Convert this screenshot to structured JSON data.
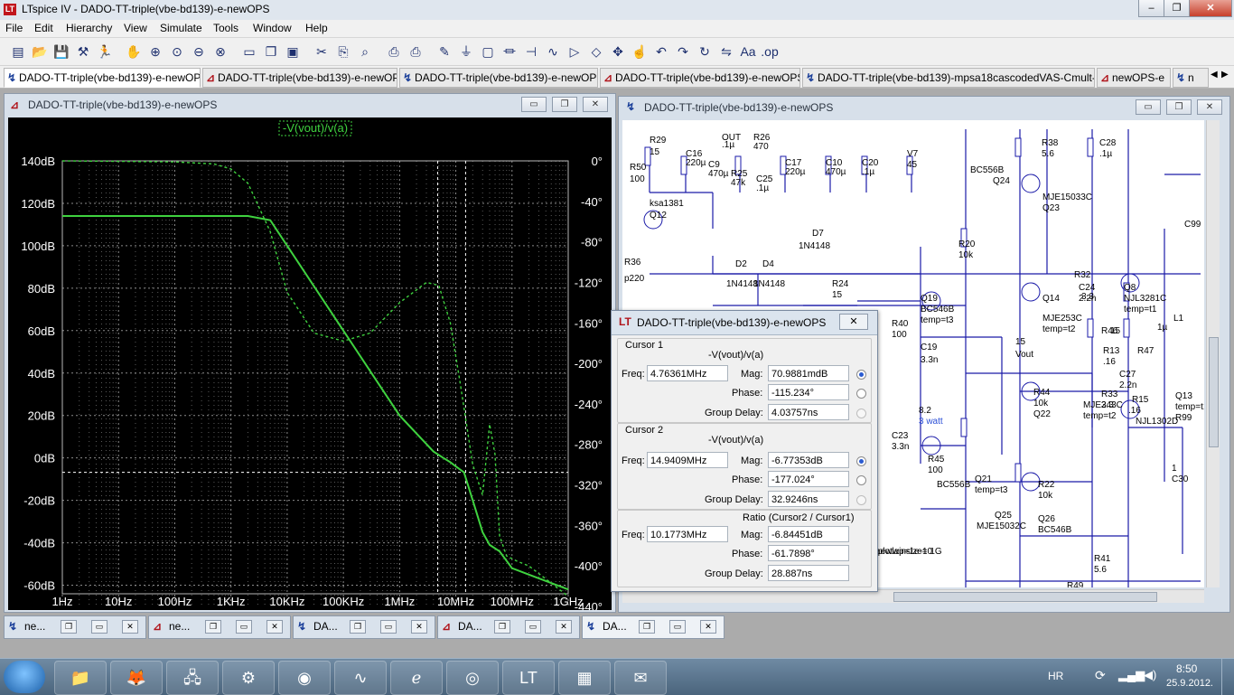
{
  "app": {
    "title": "LTspice IV - DADO-TT-triple(vbe-bd139)-e-newOPS",
    "controls": [
      "–",
      "❐",
      "✕"
    ]
  },
  "menu": [
    "File",
    "Edit",
    "Hierarchy",
    "View",
    "Simulate",
    "Tools",
    "Window",
    "Help"
  ],
  "toolbar_icons": [
    "new-schematic-icon",
    "open-icon",
    "save-icon",
    "control-panel-icon",
    "run-icon",
    "halt-icon",
    "zoom-in-icon",
    "zoom-pan-icon",
    "zoom-out-icon",
    "zoom-cancel-icon",
    "tile-horizontal-icon",
    "cascade-icon",
    "close-window-icon",
    "cut-icon",
    "copy-icon",
    "find-icon",
    "print-setup-icon",
    "print-icon",
    "wire-icon",
    "ground-icon",
    "label-icon",
    "resistor-icon",
    "capacitor-icon",
    "inductor-icon",
    "diode-icon",
    "component-icon",
    "move-icon",
    "drag-icon",
    "undo-icon",
    "redo-icon",
    "rotate-icon",
    "mirror-icon",
    "text-icon",
    "spice-directive-icon"
  ],
  "tabs": [
    {
      "label": "DADO-TT-triple(vbe-bd139)-e-newOPS",
      "icon": "schematic-icon",
      "active": true
    },
    {
      "label": "DADO-TT-triple(vbe-bd139)-e-newOPS",
      "icon": "waveform-icon",
      "active": false
    },
    {
      "label": "DADO-TT-triple(vbe-bd139)-e-newOPS-f",
      "icon": "schematic-icon",
      "active": false
    },
    {
      "label": "DADO-TT-triple(vbe-bd139)-e-newOPS-f",
      "icon": "waveform-icon",
      "active": false
    },
    {
      "label": "DADO-TT-triple(vbe-bd139)-mpsa18cascodedVAS-Cmult-mk2",
      "icon": "schematic-icon",
      "active": false
    },
    {
      "label": "newOPS-e",
      "icon": "waveform-icon",
      "active": false
    },
    {
      "label": "n",
      "icon": "schematic-icon",
      "active": false
    }
  ],
  "plot_window": {
    "title": "DADO-TT-triple(vbe-bd139)-e-newOPS",
    "controls": [
      "▭",
      "❐",
      "✕"
    ]
  },
  "schematic_window": {
    "title": "DADO-TT-triple(vbe-bd139)-e-newOPS",
    "controls": [
      "▭",
      "❐",
      "✕"
    ],
    "labels": [
      "R29",
      "15",
      "R50",
      "100",
      "C16",
      "220µ",
      "C9",
      "470µ",
      "R25",
      "47k",
      "R26",
      "470",
      "C25",
      ".1µ",
      "C17",
      "220µ",
      "C10",
      "470µ",
      "C20",
      ".1µ",
      "V7",
      "45",
      "ksa1381",
      "Q12",
      "R36",
      "p220",
      "D7",
      "1N4148",
      "D2",
      "D4",
      "1N4148",
      "1N4148",
      "R24",
      "15",
      "R20",
      "10k",
      "R38",
      "5.6",
      "C28",
      ".1µ",
      "BC556B",
      "Q24",
      "MJE15033C",
      "Q23",
      "Q19",
      "BC546B",
      "temp=t3",
      "R40",
      "100",
      "C19",
      "3.3n",
      "Q14",
      "MJE253C",
      "temp=t2",
      "R32",
      "3.3",
      "C24",
      "2.2n",
      "Q8",
      "NJL3281C",
      "temp=t1",
      "L1",
      "1µ",
      "R46",
      "15",
      "R13",
      ".16",
      "R47",
      "15",
      "Vout",
      "R44",
      "10k",
      "Q22",
      "MJE243C",
      "temp=t2",
      "R33",
      "3.3",
      "C27",
      "2.2n",
      "R15",
      ".16",
      "NJL1302D",
      "Q13",
      "temp=t1",
      "R99",
      "8.2",
      "3 watt",
      "C23",
      "3.3n",
      "R45",
      "100",
      "BC556B",
      "Q21",
      "temp=t3",
      "R22",
      "10k",
      "Q25",
      "MJE15032C",
      "Q26",
      "BC546B",
      "R41",
      "5.6",
      "R49",
      "1",
      "C30",
      "C99",
      ".1µ",
      "OUT",
      ".option plotwinsize=0",
      "aewlap=1e-1 1G"
    ]
  },
  "chart_data": {
    "type": "line",
    "title": "-V(vout)/v(a)",
    "xscale": "log",
    "x_ticks": [
      "1Hz",
      "10Hz",
      "100Hz",
      "1KHz",
      "10KHz",
      "100KHz",
      "1MHz",
      "10MHz",
      "100MHz",
      "1GHz"
    ],
    "xlim": [
      1,
      1000000000
    ],
    "y_left_ticks": [
      "140dB",
      "120dB",
      "100dB",
      "80dB",
      "60dB",
      "40dB",
      "20dB",
      "0dB",
      "-20dB",
      "-40dB",
      "-60dB"
    ],
    "ylim_left": [
      -70,
      140
    ],
    "y_right_ticks": [
      "0°",
      "-40°",
      "-80°",
      "-120°",
      "-160°",
      "-200°",
      "-240°",
      "-280°",
      "-320°",
      "-360°",
      "-400°",
      "-440°"
    ],
    "ylim_right": [
      -440,
      0
    ],
    "grid": true,
    "series": [
      {
        "name": "magnitude",
        "style": "solid",
        "color": "#3fd23f",
        "x": [
          1,
          1000,
          2000,
          5000,
          10000,
          100000,
          1000000,
          4000000,
          6000000,
          8000000,
          10000000,
          14000000,
          20000000,
          30000000,
          40000000,
          60000000,
          100000000,
          200000000,
          1000000000
        ],
        "y": [
          114,
          114,
          114,
          112,
          100,
          60,
          20,
          3,
          0,
          -2,
          -4,
          -6.8,
          -20,
          -35,
          -41,
          -44,
          -52,
          -55,
          -62
        ]
      },
      {
        "name": "phase",
        "style": "dotted",
        "color": "#3fd23f",
        "x": [
          1,
          100,
          500,
          1000,
          2000,
          5000,
          10000,
          30000,
          100000,
          300000,
          1000000,
          3000000,
          5000000,
          8000000,
          12000000,
          20000000,
          30000000,
          40000000,
          50000000,
          60000000,
          80000000,
          120000000,
          200000000,
          1000000000
        ],
        "y": [
          0,
          -1,
          -3,
          -8,
          -22,
          -70,
          -130,
          -170,
          -178,
          -170,
          -140,
          -120,
          -123,
          -160,
          -220,
          -300,
          -330,
          -260,
          -290,
          -370,
          -390,
          -395,
          -400,
          -430
        ]
      }
    ],
    "cursor_x": [
      4763610,
      14940900
    ]
  },
  "cursor_dialog": {
    "title": "DADO-TT-triple(vbe-bd139)-e-newOPS",
    "close": "✕",
    "cursor1": {
      "heading": "Cursor 1",
      "trace": "-V(vout)/v(a)",
      "freq_label": "Freq:",
      "freq": "4.76361MHz",
      "mag_label": "Mag:",
      "mag": "70.9881mdB",
      "phase_label": "Phase:",
      "phase": "-115.234°",
      "gd_label": "Group Delay:",
      "gd": "4.03757ns"
    },
    "cursor2": {
      "heading": "Cursor 2",
      "trace": "-V(vout)/v(a)",
      "freq_label": "Freq:",
      "freq": "14.9409MHz",
      "mag_label": "Mag:",
      "mag": "-6.77353dB",
      "phase_label": "Phase:",
      "phase": "-177.024°",
      "gd_label": "Group Delay:",
      "gd": "32.9246ns"
    },
    "ratio": {
      "heading": "Ratio (Cursor2 / Cursor1)",
      "freq_label": "Freq:",
      "freq": "10.1773MHz",
      "mag_label": "Mag:",
      "mag": "-6.84451dB",
      "phase_label": "Phase:",
      "phase": "-61.7898°",
      "gd_label": "Group Delay:",
      "gd": "28.887ns"
    }
  },
  "minimized": [
    {
      "label": "ne...",
      "icon": "schematic-icon"
    },
    {
      "label": "ne...",
      "icon": "waveform-icon"
    },
    {
      "label": "DA...",
      "icon": "schematic-icon"
    },
    {
      "label": "DA...",
      "icon": "waveform-icon"
    },
    {
      "label": "DA...",
      "icon": "schematic-icon"
    }
  ],
  "taskbar": {
    "lang": "HR",
    "time": "8:50",
    "date": "25.9.2012.",
    "apps": [
      "explorer-icon",
      "firefox-icon",
      "network-icon",
      "tool-icon",
      "antivirus-icon",
      "oscilloscope-icon",
      "ie-icon",
      "media-icon",
      "ltspice-icon",
      "notepad-icon",
      "editor-icon"
    ]
  }
}
